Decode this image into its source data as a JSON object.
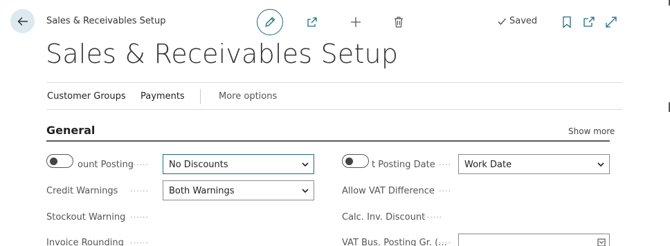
{
  "header": {
    "breadcrumb": "Sales & Receivables Setup",
    "saved_label": "Saved",
    "page_title": "Sales & Receivables Setup"
  },
  "actions": {
    "customer_groups": "Customer Groups",
    "payments": "Payments",
    "more_options": "More options"
  },
  "section": {
    "title": "General",
    "show_more": "Show more"
  },
  "fields": {
    "discount_posting": {
      "label": "ount Posting",
      "value": "No Discounts",
      "toggle_on": false
    },
    "credit_warnings": {
      "label": "Credit Warnings",
      "value": "Both Warnings"
    },
    "stockout_warning": {
      "label": "Stockout Warning"
    },
    "invoice_rounding": {
      "label": "Invoice Rounding"
    },
    "default_posting_date": {
      "label": "t Posting Date",
      "value": "Work Date",
      "toggle_on": false
    },
    "allow_vat_difference": {
      "label": "Allow VAT Difference"
    },
    "calc_inv_discount": {
      "label": "Calc. Inv. Discount"
    },
    "vat_bus_posting_gr": {
      "label": "VAT Bus. Posting Gr. (..."
    }
  },
  "colors": {
    "accent": "#1b6c86",
    "back_button_bg": "#dce9ef",
    "section_rule": "#505c66"
  },
  "icons": [
    "back-arrow-icon",
    "pencil-icon",
    "share-icon",
    "plus-icon",
    "trash-icon",
    "check-icon",
    "bookmark-icon",
    "open-new-window-icon",
    "expand-icon",
    "chevron-down-icon",
    "lookup-icon"
  ]
}
